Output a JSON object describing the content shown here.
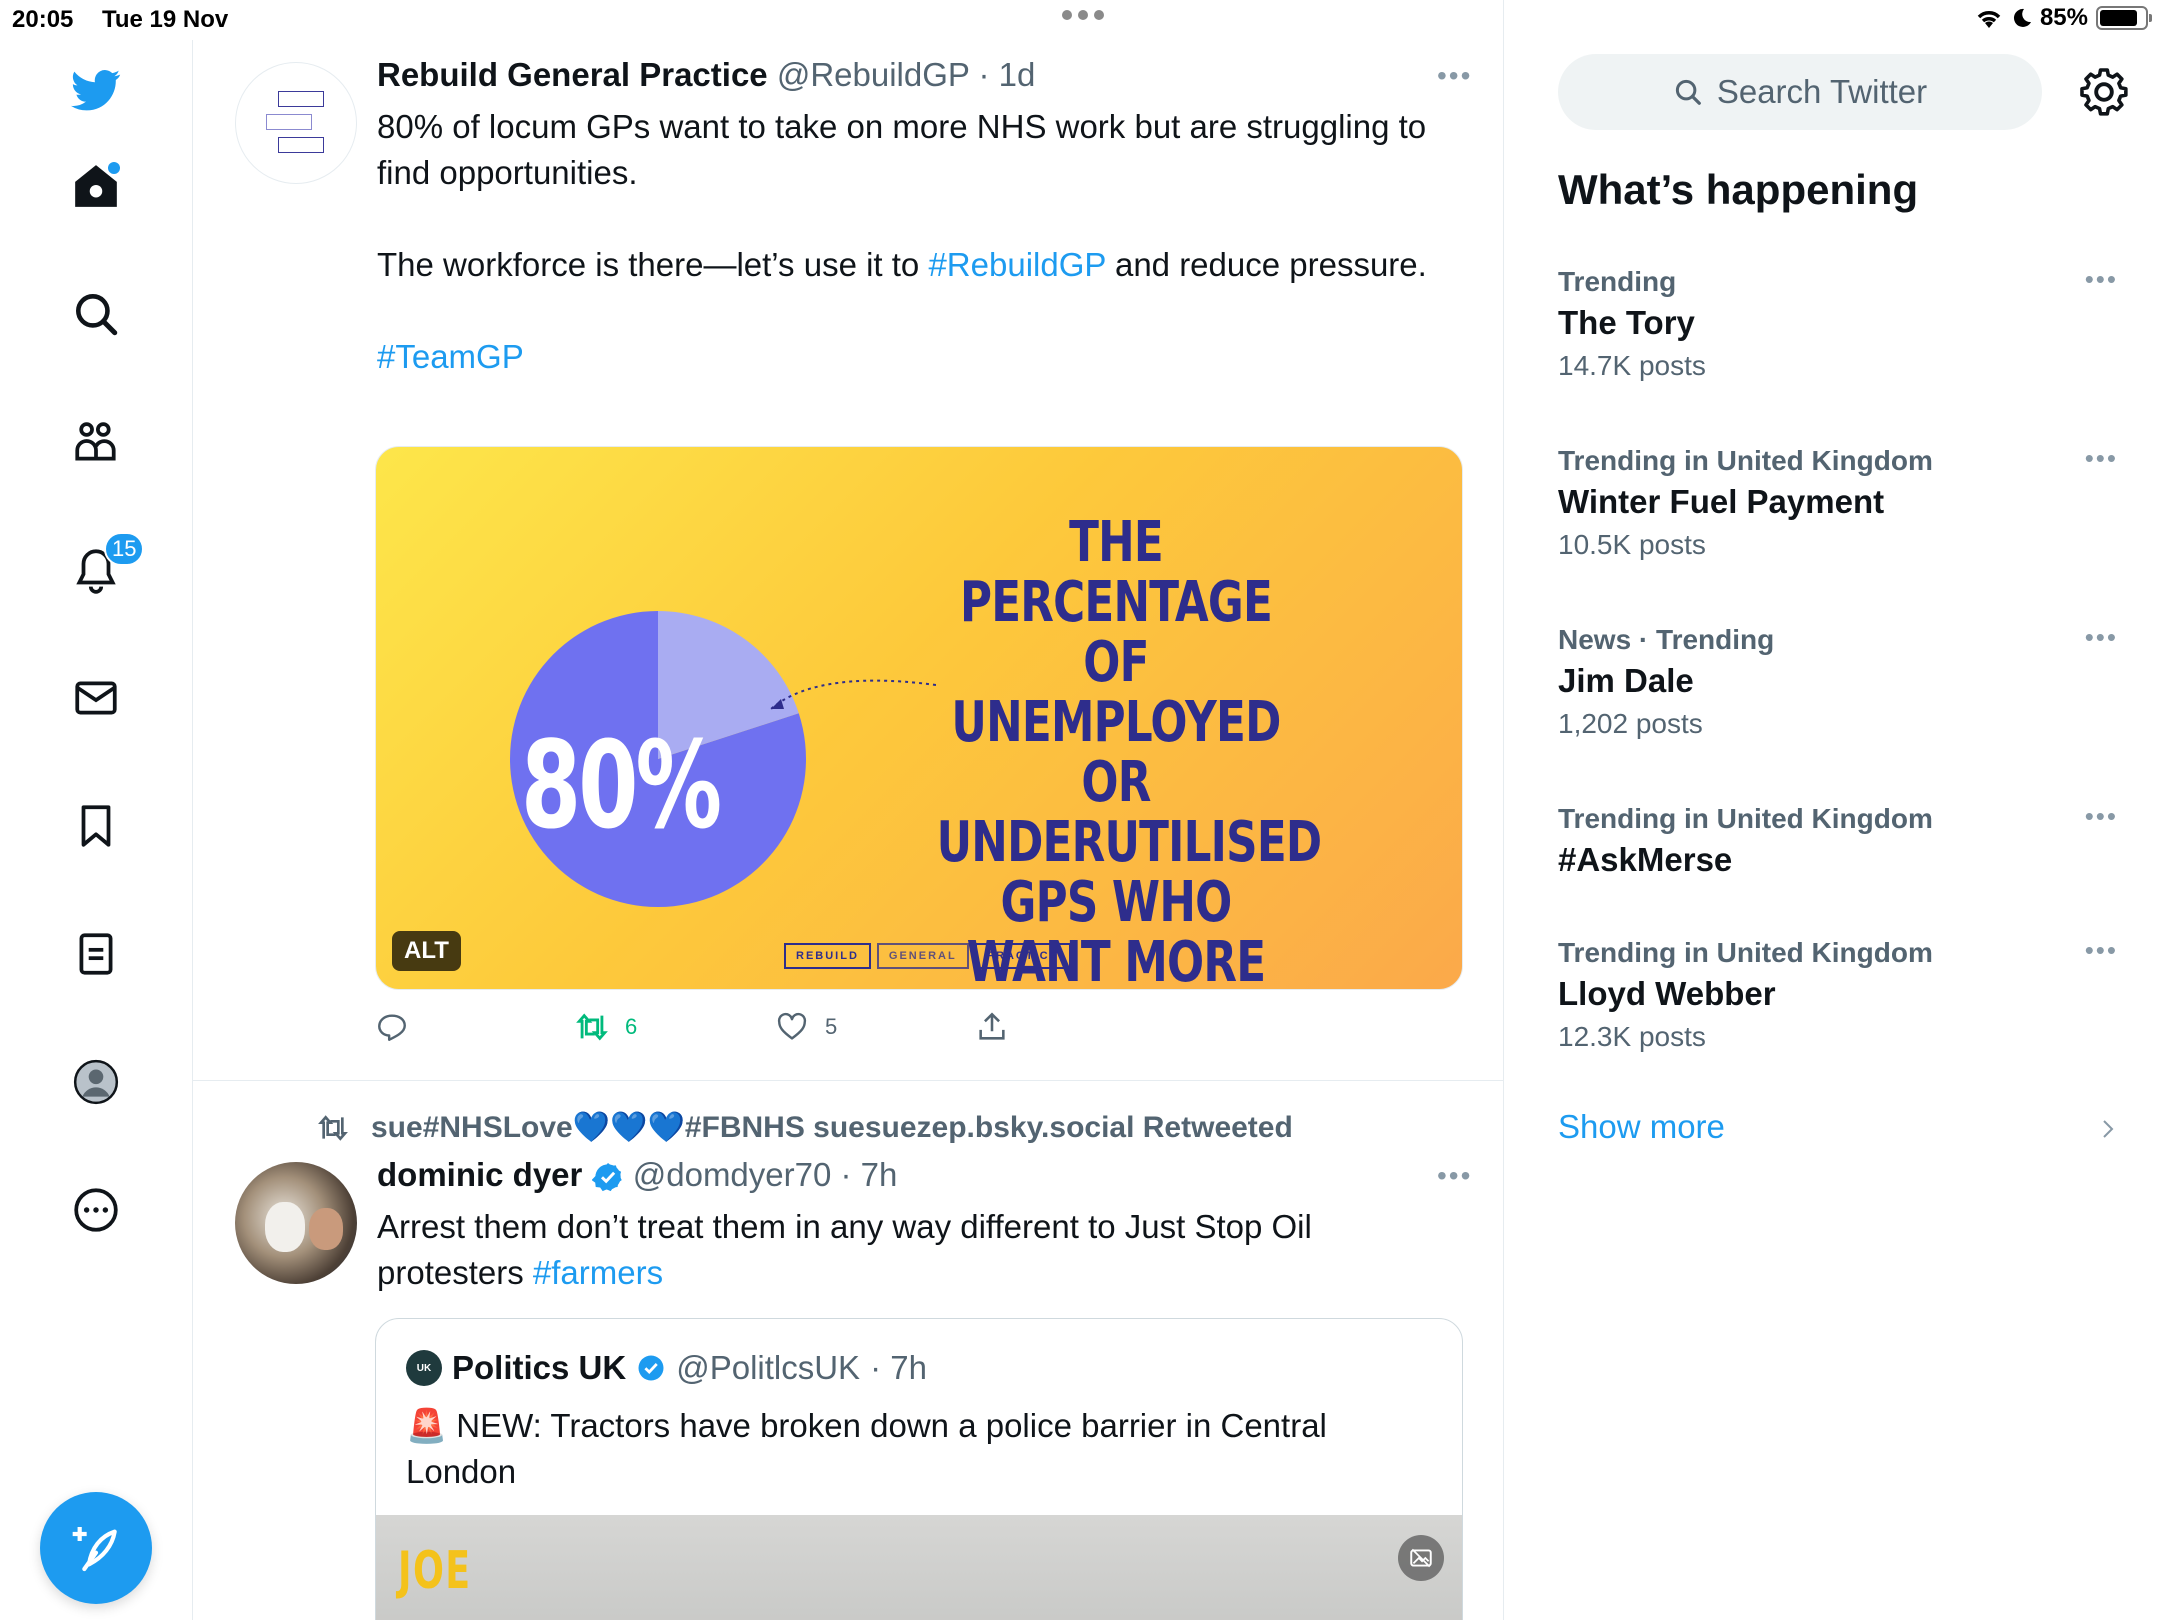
{
  "status_bar": {
    "time": "20:05",
    "date": "Tue 19 Nov",
    "battery": "85%",
    "battery_level": 0.85
  },
  "nav": {
    "notifications_badge": "15",
    "icons": [
      "twitter-logo-icon",
      "home-icon",
      "search-icon",
      "communities-icon",
      "bell-icon",
      "mail-icon",
      "bookmark-icon",
      "lists-icon",
      "profile-icon",
      "more-circle-icon",
      "compose-icon"
    ]
  },
  "tweet1": {
    "name": "Rebuild General Practice",
    "handle": "@RebuildGP",
    "time": "· 1d",
    "text_line1": "80% of locum GPs want to take on more NHS work but are struggling to find opportunities.",
    "text_line2a": "The workforce is there—let’s use it to ",
    "hashtag1": "#RebuildGP",
    "text_line2b": " and reduce pressure.",
    "hashtag2": "#TeamGP",
    "media": {
      "pie_percent": 80,
      "pie_label": "80%",
      "headline": "THE PERCENTAGE OF UNEMPLOYED OR UNDERUTILISED GPS WHO WANT MORE NHS WORK BUT ARE STRUGGLING TO FIND IT",
      "alt": "ALT",
      "logo": [
        "REBUILD",
        "GENERAL",
        "PRACTICE"
      ]
    },
    "retweets": "6",
    "likes": "5"
  },
  "tweet2": {
    "retweeted_by": "sue#NHSLove",
    "retweeted_hearts": "💙💙💙",
    "retweeted_suffix": "#FBNHS suesuezep.bsky.social Retweeted",
    "name": "dominic dyer",
    "handle": "@domdyer70",
    "time": "· 7h",
    "text": "Arrest them don’t treat them in any way different to Just Stop Oil protesters ",
    "hashtag": "#farmers",
    "quote": {
      "name": "Politics UK",
      "handle": "@PolitlcsUK",
      "time": "· 7h",
      "emoji": "🚨",
      "text": " NEW: Tractors have broken down a police barrier in Central London",
      "image_text": "JOE"
    }
  },
  "sidebar": {
    "search_placeholder": "Search Twitter",
    "title": "What’s happening",
    "trends": [
      {
        "context": "Trending",
        "topic": "The Tory",
        "count": "14.7K posts"
      },
      {
        "context": "Trending in United Kingdom",
        "topic": "Winter Fuel Payment",
        "count": "10.5K posts"
      },
      {
        "context": "News · Trending",
        "topic": "Jim Dale",
        "count": "1,202 posts"
      },
      {
        "context": "Trending in United Kingdom",
        "topic": "#AskMerse",
        "count": ""
      },
      {
        "context": "Trending in United Kingdom",
        "topic": "Lloyd Webber",
        "count": "12.3K posts"
      }
    ],
    "show_more": "Show more"
  },
  "colors": {
    "accent": "#1d9bf0",
    "retweet_green": "#00ba7c",
    "pie_main": "#6f71f0",
    "pie_slice": "#a9acf2",
    "headline_navy": "#2e2d8c"
  }
}
